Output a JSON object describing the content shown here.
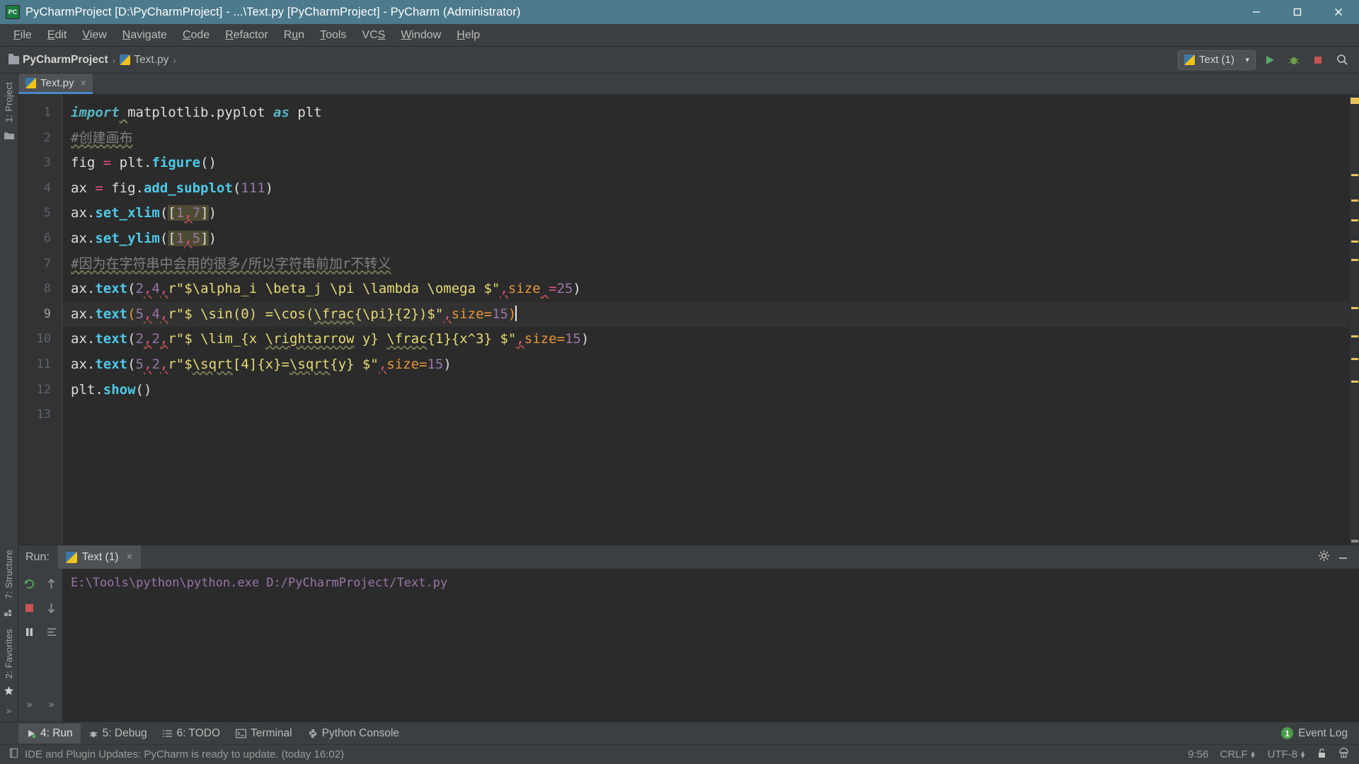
{
  "window": {
    "title": "PyCharmProject [D:\\PyCharmProject] - ...\\Text.py [PyCharmProject] - PyCharm (Administrator)",
    "app_icon": "pycharm-icon",
    "minimize": "─",
    "maximize": "❐",
    "close": "✕",
    "titlebar_color": "#4d7a8c"
  },
  "menubar": {
    "items": [
      {
        "label": "File",
        "mnemonic": "F"
      },
      {
        "label": "Edit",
        "mnemonic": "E"
      },
      {
        "label": "View",
        "mnemonic": "V"
      },
      {
        "label": "Navigate",
        "mnemonic": "N"
      },
      {
        "label": "Code",
        "mnemonic": "C"
      },
      {
        "label": "Refactor",
        "mnemonic": "R"
      },
      {
        "label": "Run",
        "mnemonic": "u"
      },
      {
        "label": "Tools",
        "mnemonic": "T"
      },
      {
        "label": "VCS",
        "mnemonic": "S"
      },
      {
        "label": "Window",
        "mnemonic": "W"
      },
      {
        "label": "Help",
        "mnemonic": "H"
      }
    ]
  },
  "navbar": {
    "breadcrumbs": [
      {
        "label": "PyCharmProject",
        "icon": "folder-icon"
      },
      {
        "label": "Text.py",
        "icon": "python-file-icon"
      }
    ],
    "separator": "›",
    "run_config": {
      "label": "Text (1)",
      "icon": "python-file-icon",
      "dropdown": "▾"
    },
    "buttons": [
      {
        "name": "run-button",
        "icon": "play-icon"
      },
      {
        "name": "debug-button",
        "icon": "bug-icon"
      },
      {
        "name": "stop-button",
        "icon": "stop-icon"
      },
      {
        "name": "search-button",
        "icon": "search-icon"
      }
    ]
  },
  "left_strip": {
    "top_items": [
      {
        "label": "1: Project",
        "name": "tool-project"
      }
    ],
    "bottom_items": [
      {
        "label": "7: Structure",
        "name": "tool-structure"
      },
      {
        "label": "2: Favorites",
        "name": "tool-favorites"
      }
    ]
  },
  "editor": {
    "tabs": [
      {
        "label": "Text.py",
        "icon": "python-file-icon",
        "close": "×",
        "active": true
      }
    ],
    "current_line": 9,
    "line_numbers": [
      "1",
      "2",
      "3",
      "4",
      "5",
      "6",
      "7",
      "8",
      "9",
      "10",
      "11",
      "12",
      "13"
    ],
    "lines": [
      {
        "n": 1,
        "text": "import matplotlib.pyplot as plt"
      },
      {
        "n": 2,
        "text": "#创建画布"
      },
      {
        "n": 3,
        "text": "fig = plt.figure()"
      },
      {
        "n": 4,
        "text": "ax = fig.add_subplot(111)"
      },
      {
        "n": 5,
        "text": "ax.set_xlim([1,7])"
      },
      {
        "n": 6,
        "text": "ax.set_ylim([1,5])"
      },
      {
        "n": 7,
        "text": "#因为在字符串中会用的很多/所以字符串前加r不转义"
      },
      {
        "n": 8,
        "text": "ax.text(2,4,r\"$\\alpha_i \\beta_j \\pi \\lambda \\omega $\",size =25)"
      },
      {
        "n": 9,
        "text": "ax.text(5,4,r\"$ \\sin(0) =\\cos(\\frac{\\pi}{2})$\",size=15)"
      },
      {
        "n": 10,
        "text": "ax.text(2,2,r\"$ \\lim_{x \\rightarrow y} \\frac{1}{x^3} $\",size=15)"
      },
      {
        "n": 11,
        "text": "ax.text(5,2,r\"$\\sqrt[4]{x}=\\sqrt{y} $\",size=15)"
      },
      {
        "n": 12,
        "text": "plt.show()"
      },
      {
        "n": 13,
        "text": ""
      }
    ]
  },
  "run_panel": {
    "label": "Run:",
    "tab": {
      "label": "Text (1)",
      "icon": "python-file-icon",
      "close": "×"
    },
    "console_output": "E:\\Tools\\python\\python.exe D:/PyCharmProject/Text.py",
    "sidebar_buttons": [
      {
        "name": "rerun-button",
        "icon": "rerun-icon"
      },
      {
        "name": "scroll-up-button",
        "icon": "arrow-up-icon"
      },
      {
        "name": "stop-button",
        "icon": "stop-square-icon"
      },
      {
        "name": "scroll-down-button",
        "icon": "arrow-down-icon"
      },
      {
        "name": "pause-button",
        "icon": "pause-icon"
      },
      {
        "name": "soft-wrap-button",
        "icon": "wrap-icon"
      },
      {
        "name": "expand-more-button",
        "icon": "chevrons-icon"
      },
      {
        "name": "expand-more-button-2",
        "icon": "chevrons-icon"
      }
    ],
    "header_buttons": [
      {
        "name": "settings-button",
        "icon": "gear-icon"
      },
      {
        "name": "hide-button",
        "icon": "minimize-icon"
      }
    ]
  },
  "bottom_toolbar": {
    "items": [
      {
        "label": "4: Run",
        "mnemonic": "4",
        "icon": "play-icon",
        "active": true,
        "name": "tool-run"
      },
      {
        "label": "5: Debug",
        "mnemonic": "5",
        "icon": "bug-icon",
        "active": false,
        "name": "tool-debug"
      },
      {
        "label": "6: TODO",
        "mnemonic": "6",
        "icon": "list-icon",
        "active": false,
        "name": "tool-todo"
      },
      {
        "label": "Terminal",
        "mnemonic": "",
        "icon": "terminal-icon",
        "active": false,
        "name": "tool-terminal"
      },
      {
        "label": "Python Console",
        "mnemonic": "",
        "icon": "python-icon",
        "active": false,
        "name": "tool-python-console"
      }
    ],
    "event_log": {
      "label": "Event Log",
      "count": "1"
    }
  },
  "statusbar": {
    "message": "IDE and Plugin Updates: PyCharm is ready to update. (today 16:02)",
    "message_icon": "notification-icon",
    "position": "9:56",
    "line_separator": "CRLF",
    "encoding": "UTF-8",
    "lock_icon": "unlocked-icon",
    "inspection_icon": "hector-icon"
  },
  "colors": {
    "accent": "#4a88c7",
    "titlebar": "#4d7a8c",
    "editor_bg": "#2b2b2b",
    "panel_bg": "#3c3f41",
    "string": "#e7db74",
    "keyword": "#cc7832",
    "number": "#9876aa"
  }
}
